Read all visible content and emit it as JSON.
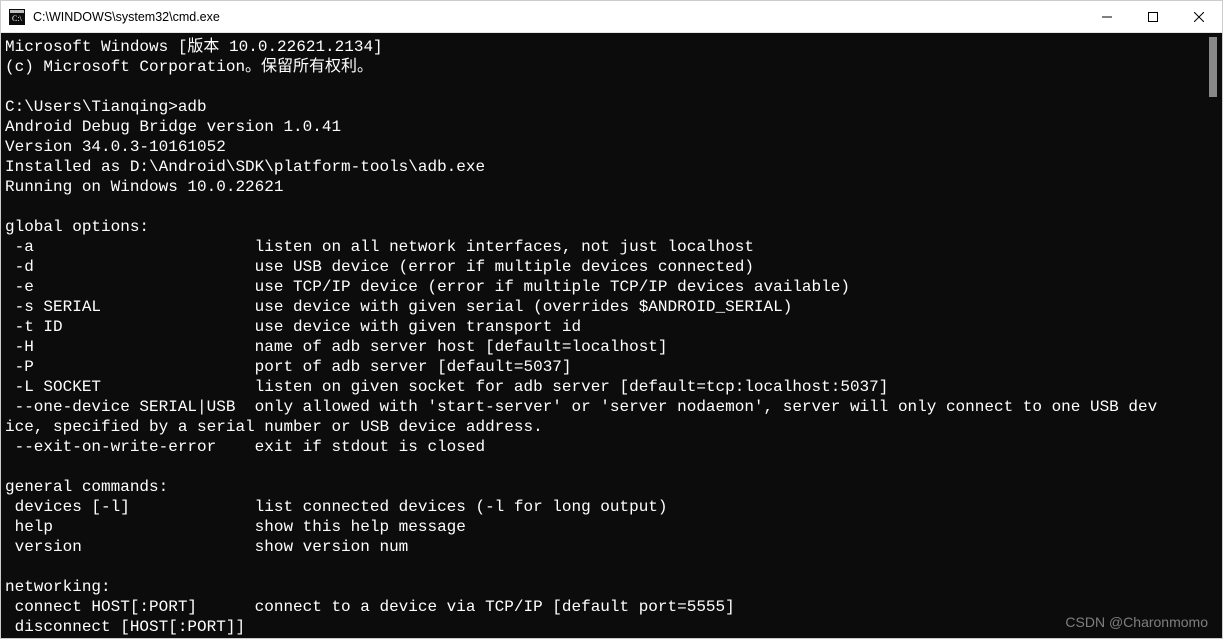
{
  "titlebar": {
    "title": "C:\\WINDOWS\\system32\\cmd.exe"
  },
  "terminal": {
    "l01": "Microsoft Windows [版本 10.0.22621.2134]",
    "l02": "(c) Microsoft Corporation。保留所有权利。",
    "l03": "",
    "l04": "C:\\Users\\Tianqing>adb",
    "l05": "Android Debug Bridge version 1.0.41",
    "l06": "Version 34.0.3-10161052",
    "l07": "Installed as D:\\Android\\SDK\\platform-tools\\adb.exe",
    "l08": "Running on Windows 10.0.22621",
    "l09": "",
    "l10": "global options:",
    "l11": " -a                       listen on all network interfaces, not just localhost",
    "l12": " -d                       use USB device (error if multiple devices connected)",
    "l13": " -e                       use TCP/IP device (error if multiple TCP/IP devices available)",
    "l14": " -s SERIAL                use device with given serial (overrides $ANDROID_SERIAL)",
    "l15": " -t ID                    use device with given transport id",
    "l16": " -H                       name of adb server host [default=localhost]",
    "l17": " -P                       port of adb server [default=5037]",
    "l18": " -L SOCKET                listen on given socket for adb server [default=tcp:localhost:5037]",
    "l19": " --one-device SERIAL|USB  only allowed with 'start-server' or 'server nodaemon', server will only connect to one USB dev",
    "l20": "ice, specified by a serial number or USB device address.",
    "l21": " --exit-on-write-error    exit if stdout is closed",
    "l22": "",
    "l23": "general commands:",
    "l24": " devices [-l]             list connected devices (-l for long output)",
    "l25": " help                     show this help message",
    "l26": " version                  show version num",
    "l27": "",
    "l28": "networking:",
    "l29": " connect HOST[:PORT]      connect to a device via TCP/IP [default port=5555]",
    "l30": " disconnect [HOST[:PORT]]"
  },
  "watermark": "CSDN @Charonmomo"
}
